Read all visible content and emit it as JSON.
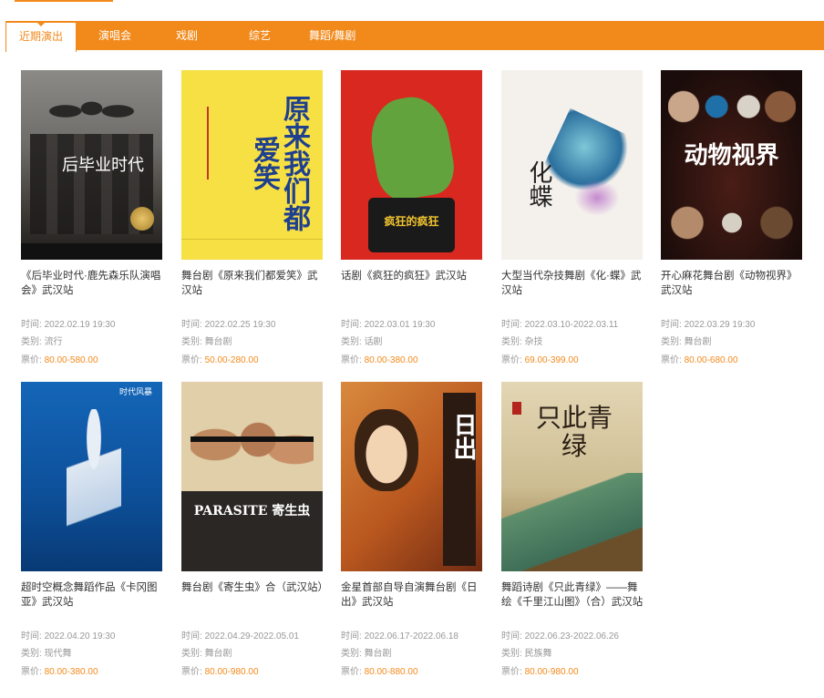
{
  "tabs": [
    {
      "label": "近期演出",
      "active": true
    },
    {
      "label": "演唱会",
      "active": false
    },
    {
      "label": "戏剧",
      "active": false
    },
    {
      "label": "综艺",
      "active": false
    },
    {
      "label": "舞蹈/舞剧",
      "active": false
    }
  ],
  "labels": {
    "time": "时间: ",
    "category": "类别: ",
    "price": "票价: "
  },
  "accent_color": "#f28a1b",
  "shows": [
    {
      "title": "《后毕业时代·鹿先森乐队演唱会》武汉站",
      "time": "2022.02.19 19:30",
      "category": "流行",
      "price": "80.00-580.00",
      "poster_text": "后毕业时代"
    },
    {
      "title": "舞台剧《原来我们都爱笑》武汉站",
      "time": "2022.02.25 19:30",
      "category": "舞台剧",
      "price": "50.00-280.00",
      "poster_text": "原来我们都爱笑"
    },
    {
      "title": "话剧《疯狂的疯狂》武汉站",
      "time": "2022.03.01 19:30",
      "category": "话剧",
      "price": "80.00-380.00",
      "poster_text": "疯狂的疯狂"
    },
    {
      "title": "大型当代杂技舞剧《化·蝶》武汉站",
      "time": "2022.03.10-2022.03.11",
      "category": "杂技",
      "price": "69.00-399.00",
      "poster_text": "化蝶"
    },
    {
      "title": "开心麻花舞台剧《动物视界》武汉站",
      "time": "2022.03.29 19:30",
      "category": "舞台剧",
      "price": "80.00-680.00",
      "poster_text": "动物视界"
    },
    {
      "title": "超时空概念舞蹈作品《卡冈图亚》武汉站",
      "time": "2022.04.20 19:30",
      "category": "现代舞",
      "price": "80.00-380.00",
      "poster_text": "时代风暴"
    },
    {
      "title": "舞台剧《寄生虫》合（武汉站）",
      "time": "2022.04.29-2022.05.01",
      "category": "舞台剧",
      "price": "80.00-980.00",
      "poster_text": "PARASITE 寄生虫"
    },
    {
      "title": "金星首部自导自演舞台剧《日出》武汉站",
      "time": "2022.06.17-2022.06.18",
      "category": "舞台剧",
      "price": "80.00-880.00",
      "poster_text": "日出"
    },
    {
      "title": "舞蹈诗剧《只此青绿》——舞绘《千里江山图》（合）武汉站",
      "time": "2022.06.23-2022.06.26",
      "category": "民族舞",
      "price": "80.00-980.00",
      "poster_text": "只此青绿"
    }
  ]
}
